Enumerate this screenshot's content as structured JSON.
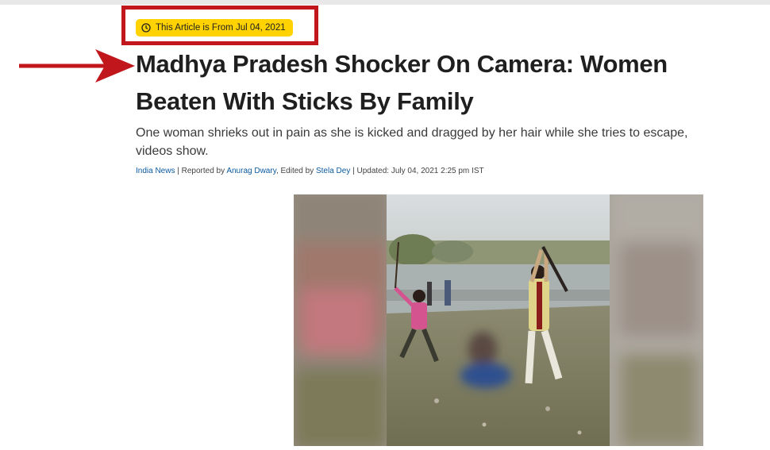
{
  "badge": {
    "text": "This Article is From Jul 04, 2021",
    "icon": "clock-icon"
  },
  "article": {
    "headline": "Madhya Pradesh Shocker On Camera: Women Beaten With Sticks By Family",
    "summary": "One woman shrieks out in pain as she is kicked and dragged by her hair while she tries to escape, videos show."
  },
  "byline": {
    "category": "India News",
    "sep1": " | Reported by ",
    "reporter": "Anurag Dwary",
    "sep2": ", Edited by ",
    "editor": "Stela Dey",
    "updated": " | Updated: July 04, 2021 2:25 pm IST"
  },
  "colors": {
    "highlight": "#c0161c",
    "badge": "#ffd200",
    "link": "#0b5aa0"
  }
}
